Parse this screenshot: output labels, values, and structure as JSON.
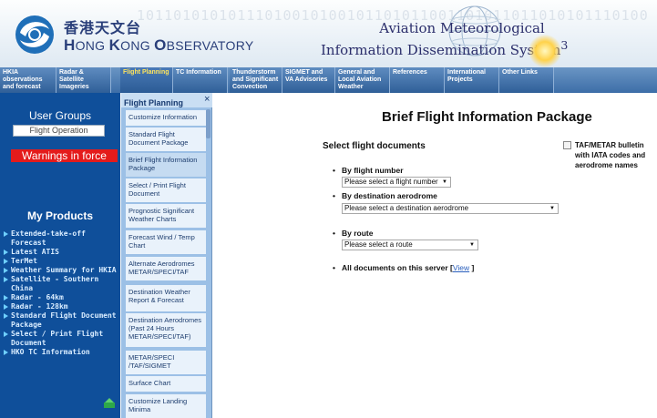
{
  "header": {
    "org_chinese": "香港天文台",
    "org_english_big": "H",
    "org_english_rest": "ONG ",
    "org_english_big2": "K",
    "org_english_rest2": "ONG ",
    "org_english_big3": "O",
    "org_english_rest3": "BSERVATORY",
    "system_line1": "Aviation Meteorological",
    "system_line2": "Information Dissemination System",
    "system_sup": "3",
    "binary": "10110101010111010010100101101011001101011011010101110100101001011010110011010110101011101001010010110101100110"
  },
  "nav": [
    {
      "label": "HKIA observations and forecast",
      "active": false
    },
    {
      "label": "Radar & Satellite Imageries",
      "active": false
    },
    {
      "label": "Flight Planning",
      "active": true
    },
    {
      "label": "TC Information",
      "active": false
    },
    {
      "label": "Thunderstorm and Significant Convection",
      "active": false
    },
    {
      "label": "SIGMET and VA Advisories",
      "active": false
    },
    {
      "label": "General and Local Aviation Weather",
      "active": false
    },
    {
      "label": "References",
      "active": false
    },
    {
      "label": "International Projects",
      "active": false
    },
    {
      "label": "Other Links",
      "active": false
    }
  ],
  "sidebar": {
    "user_groups_title": "User Groups",
    "user_group_value": "Flight Operation",
    "warnings_label": "Warnings in force",
    "my_products_title": "My Products",
    "products": [
      "Extended-take-off Forecast",
      "Latest ATIS",
      "TerMet",
      "Weather Summary for HKIA",
      "Satellite - Southern China",
      "Radar - 64km",
      "Radar - 128km",
      "Standard Flight Document Package",
      "Select / Print Flight Document",
      "HKO TC Information"
    ]
  },
  "flight_planning": {
    "title": "Flight Planning",
    "close_symbol": "×",
    "items": [
      {
        "label": "Customize Information",
        "active": false
      },
      {
        "label": "Standard Flight Document Package",
        "active": false
      },
      {
        "label": "Brief Flight Information Package",
        "active": true
      },
      {
        "label": "Select / Print Flight Document",
        "active": false
      },
      {
        "label": "Prognostic Significant Weather Charts",
        "active": false
      },
      {
        "label": "Forecast Wind / Temp Chart",
        "active": false
      },
      {
        "label": "Alternate Aerodromes METAR/SPECI/TAF",
        "active": false
      },
      {
        "label": "Destination Weather Report & Forecast",
        "active": false
      },
      {
        "label": "Destination Aerodromes (Past 24 Hours METAR/SPECI/TAF)",
        "active": false
      },
      {
        "label": "METAR/SPECI /TAF/SIGMET",
        "active": false
      },
      {
        "label": "Surface Chart",
        "active": false
      },
      {
        "label": "Customize Landing Minima",
        "active": false
      }
    ]
  },
  "main": {
    "page_title": "Brief Flight Information Package",
    "select_heading": "Select flight documents",
    "by_flight_label": "By flight number",
    "flight_select": "Please select a flight number",
    "by_dest_label": "By destination aerodrome",
    "dest_select": "Please select a destination aerodrome",
    "by_route_label": "By route",
    "route_select": "Please select a route",
    "all_docs_label": "All documents on this server [",
    "view_link": "View",
    "all_docs_close": " ]",
    "checkbox_label": "TAF/METAR bulletin with IATA codes and aerodrome names",
    "dropdown_arrow": "▼"
  },
  "colors": {
    "sidebar_bg": "#0f4f9a",
    "warning_red": "#e41b1b",
    "nav_blue": "#3d6ea8",
    "active_tab_text": "#ffe45c"
  }
}
